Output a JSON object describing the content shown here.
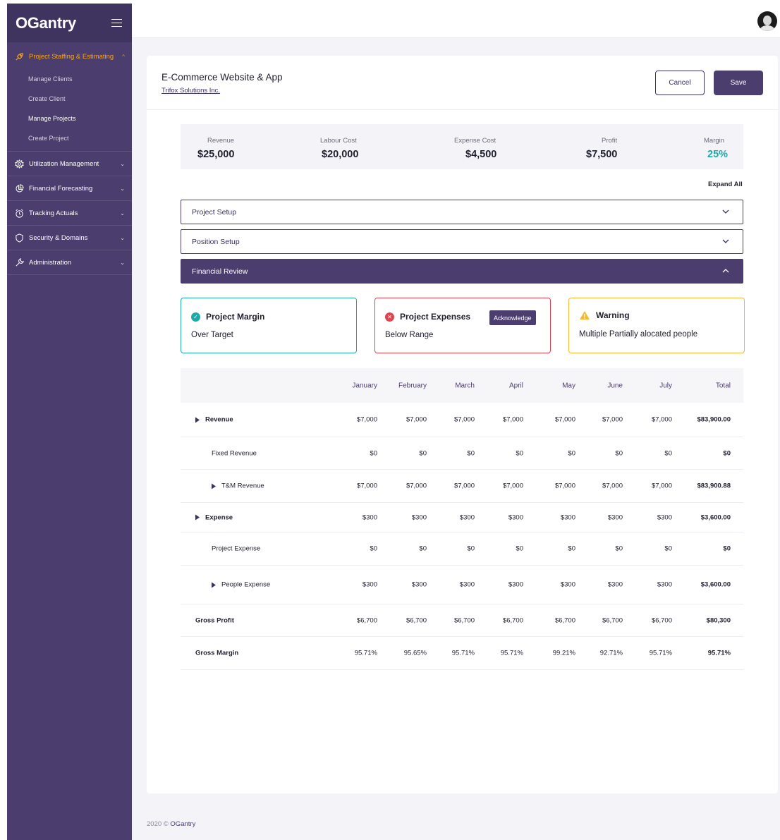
{
  "app": {
    "logo": "OGantry"
  },
  "sidebar": {
    "groups": [
      {
        "label": "Project Staffing & Estimating",
        "icon": "rocket-icon",
        "active": true,
        "items": [
          "Manage Clients",
          "Create Client",
          "Manage Projects",
          "Create Project"
        ],
        "current": "Manage Projects"
      },
      {
        "label": "Utilization Management",
        "icon": "gear-icon"
      },
      {
        "label": "Financial Forecasting",
        "icon": "pie-chart-icon"
      },
      {
        "label": "Tracking Actuals",
        "icon": "alarm-clock-icon"
      },
      {
        "label": "Security & Domains",
        "icon": "shield-icon"
      },
      {
        "label": "Administration",
        "icon": "wrench-icon"
      }
    ]
  },
  "header": {
    "title": "E-Commerce Website & App",
    "client": "Trifox Solutions Inc.",
    "cancel_label": "Cancel",
    "save_label": "Save"
  },
  "summary": [
    {
      "label": "Revenue",
      "value": "$25,000"
    },
    {
      "label": "Labour Cost",
      "value": "$20,000"
    },
    {
      "label": "Expense Cost",
      "value": "$4,500"
    },
    {
      "label": "Profit",
      "value": "$7,500"
    },
    {
      "label": "Margin",
      "value": "25%"
    }
  ],
  "colors": {
    "brand": "#4b3d6e",
    "accent": "#f5a623",
    "success": "#1ea9a9",
    "danger": "#e0444e",
    "warning": "#f5b830"
  },
  "expand_all": "Expand All",
  "accordions": {
    "project_setup": "Project Setup",
    "position_setup": "Position Setup",
    "financial_review": "Financial Review"
  },
  "alerts": {
    "margin": {
      "title": "Project Margin",
      "body": "Over Target"
    },
    "expenses": {
      "title": "Project Expenses",
      "body": "Below Range",
      "action": "Acknowledge"
    },
    "warning": {
      "title": "Warning",
      "body": "Multiple Partially alocated people"
    }
  },
  "table": {
    "columns": [
      "January",
      "February",
      "March",
      "April",
      "May",
      "June",
      "July",
      "Total"
    ],
    "rows": [
      {
        "label": "Revenue",
        "values": [
          "$7,000",
          "$7,000",
          "$7,000",
          "$7,000",
          "$7,000",
          "$7,000",
          "$7,000",
          "$83,900.00"
        ]
      },
      {
        "label": "Fixed Revenue",
        "values": [
          "$0",
          "$0",
          "$0",
          "$0",
          "$0",
          "$0",
          "$0",
          "$0"
        ]
      },
      {
        "label": "T&M Revenue",
        "values": [
          "$7,000",
          "$7,000",
          "$7,000",
          "$7,000",
          "$7,000",
          "$7,000",
          "$7,000",
          "$83,900.88"
        ]
      },
      {
        "label": "Expense",
        "values": [
          "$300",
          "$300",
          "$300",
          "$300",
          "$300",
          "$300",
          "$300",
          "$3,600.00"
        ]
      },
      {
        "label": "Project Expense",
        "values": [
          "$0",
          "$0",
          "$0",
          "$0",
          "$0",
          "$0",
          "$0",
          "$0"
        ]
      },
      {
        "label": "People Expense",
        "values": [
          "$300",
          "$300",
          "$300",
          "$300",
          "$300",
          "$300",
          "$300",
          "$3,600.00"
        ]
      },
      {
        "label": "Gross Profit",
        "values": [
          "$6,700",
          "$6,700",
          "$6,700",
          "$6,700",
          "$6,700",
          "$6,700",
          "$6,700",
          "$80,300"
        ]
      },
      {
        "label": "Gross Margin",
        "values": [
          "95.71%",
          "95.65%",
          "95.71%",
          "95.71%",
          "99.21%",
          "92.71%",
          "95.71%",
          "95.71%"
        ]
      }
    ]
  },
  "footer": {
    "prefix": "2020 ©",
    "brand": "OGantry"
  }
}
